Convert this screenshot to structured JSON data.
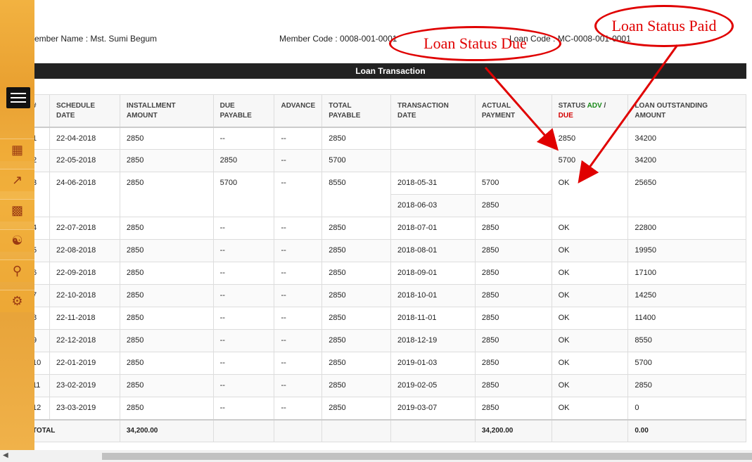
{
  "member": {
    "name_label": "ember Name : Mst. Sumi Begum",
    "code_label": "Member Code : 0008-001-0001",
    "loan_code_label": "Loan Code : MC-0008-001-0001"
  },
  "section_title": "Loan Transaction",
  "columns": [
    "#",
    "SCHEDULE DATE",
    "INSTALLMENT AMOUNT",
    "DUE PAYABLE",
    "ADVANCE",
    "TOTAL PAYABLE",
    "TRANSACTION DATE",
    "ACTUAL PAYMENT",
    "STATUS",
    "LOAN OUTSTANDING AMOUNT"
  ],
  "status_header": {
    "prefix": "STATUS ",
    "adv": "ADV",
    "sep": " /",
    "due": "DUE"
  },
  "rows": [
    {
      "n": "1",
      "schedule": "22-04-2018",
      "installment": "2850",
      "due": "--",
      "advance": "--",
      "total": "2850",
      "txdate": "",
      "payment": "",
      "status": "2850",
      "status_type": "due",
      "outstanding": "34200"
    },
    {
      "n": "2",
      "schedule": "22-05-2018",
      "installment": "2850",
      "due": "2850",
      "advance": "--",
      "total": "5700",
      "txdate": "",
      "payment": "",
      "status": "5700",
      "status_type": "due",
      "outstanding": "34200"
    },
    {
      "n": "3",
      "schedule": "24-06-2018",
      "installment": "2850",
      "due": "5700",
      "advance": "--",
      "total": "8550",
      "txdate": "2018-05-31",
      "payment": "5700",
      "txdate2": "2018-06-03",
      "payment2": "2850",
      "status": "OK",
      "status_type": "ok",
      "outstanding": "25650"
    },
    {
      "n": "4",
      "schedule": "22-07-2018",
      "installment": "2850",
      "due": "--",
      "advance": "--",
      "total": "2850",
      "txdate": "2018-07-01",
      "payment": "2850",
      "status": "OK",
      "status_type": "ok",
      "outstanding": "22800"
    },
    {
      "n": "5",
      "schedule": "22-08-2018",
      "installment": "2850",
      "due": "--",
      "advance": "--",
      "total": "2850",
      "txdate": "2018-08-01",
      "payment": "2850",
      "status": "OK",
      "status_type": "ok",
      "outstanding": "19950"
    },
    {
      "n": "6",
      "schedule": "22-09-2018",
      "installment": "2850",
      "due": "--",
      "advance": "--",
      "total": "2850",
      "txdate": "2018-09-01",
      "payment": "2850",
      "status": "OK",
      "status_type": "ok",
      "outstanding": "17100"
    },
    {
      "n": "7",
      "schedule": "22-10-2018",
      "installment": "2850",
      "due": "--",
      "advance": "--",
      "total": "2850",
      "txdate": "2018-10-01",
      "payment": "2850",
      "status": "OK",
      "status_type": "ok",
      "outstanding": "14250"
    },
    {
      "n": "8",
      "schedule": "22-11-2018",
      "installment": "2850",
      "due": "--",
      "advance": "--",
      "total": "2850",
      "txdate": "2018-11-01",
      "payment": "2850",
      "status": "OK",
      "status_type": "ok",
      "outstanding": "11400"
    },
    {
      "n": "9",
      "schedule": "22-12-2018",
      "installment": "2850",
      "due": "--",
      "advance": "--",
      "total": "2850",
      "txdate": "2018-12-19",
      "payment": "2850",
      "status": "OK",
      "status_type": "ok",
      "outstanding": "8550"
    },
    {
      "n": "10",
      "schedule": "22-01-2019",
      "installment": "2850",
      "due": "--",
      "advance": "--",
      "total": "2850",
      "txdate": "2019-01-03",
      "payment": "2850",
      "status": "OK",
      "status_type": "ok",
      "outstanding": "5700"
    },
    {
      "n": "11",
      "schedule": "23-02-2019",
      "installment": "2850",
      "due": "--",
      "advance": "--",
      "total": "2850",
      "txdate": "2019-02-05",
      "payment": "2850",
      "status": "OK",
      "status_type": "ok",
      "outstanding": "2850"
    },
    {
      "n": "12",
      "schedule": "23-03-2019",
      "installment": "2850",
      "due": "--",
      "advance": "--",
      "total": "2850",
      "txdate": "2019-03-07",
      "payment": "2850",
      "status": "OK",
      "status_type": "ok",
      "outstanding": "0"
    }
  ],
  "totals": {
    "label": "TOTAL",
    "installment": "34,200.00",
    "payment": "34,200.00",
    "outstanding": "0.00"
  },
  "annotations": {
    "due": "Loan Status Due",
    "paid": "Loan Status Paid"
  },
  "sidebar_icons": [
    "building-icon",
    "chart-icon",
    "briefcase-icon",
    "handshake-icon",
    "key-icon",
    "settings-icon"
  ],
  "colors": {
    "due": "#d40000",
    "ok": "#1a3fd6",
    "adv": "#1a8a1a",
    "annotation": "#e00000",
    "sidebar": "#f0ad3e"
  }
}
